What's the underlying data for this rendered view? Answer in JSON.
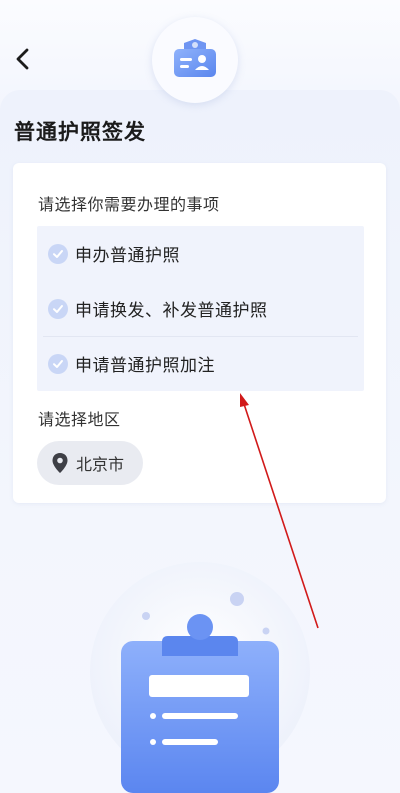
{
  "page": {
    "title": "普通护照签发"
  },
  "card": {
    "items_label": "请选择你需要办理的事项",
    "options": [
      {
        "label": "申办普通护照"
      },
      {
        "label": "申请换发、补发普通护照"
      },
      {
        "label": "申请普通护照加注"
      }
    ],
    "region_label": "请选择地区",
    "region_value": "北京市"
  },
  "colors": {
    "accent": "#5b8ef5",
    "check_bg": "#c9d6f6",
    "arrow": "#d11a1a"
  },
  "icons": {
    "back": "chevron-left-icon",
    "badge": "passport-card-icon",
    "check": "check-circle-icon",
    "pin": "location-pin-icon",
    "illustration": "clipboard-illustration"
  }
}
